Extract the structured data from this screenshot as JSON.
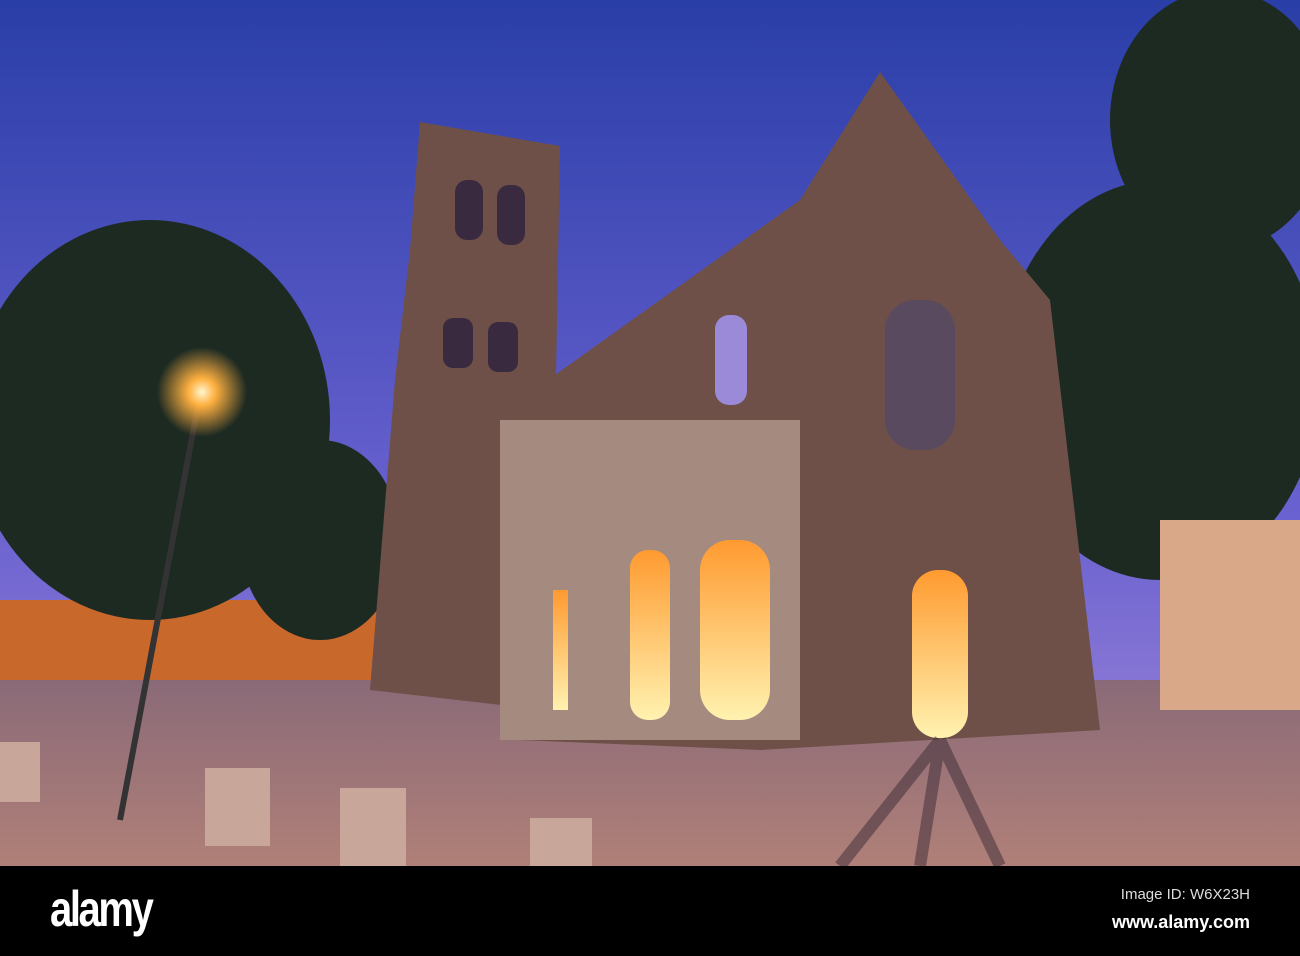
{
  "watermark": {
    "brand": "alamy",
    "image_id": "Image ID: W6X23H",
    "url": "www.alamy.com"
  },
  "colors": {
    "sky_top": "#2a3ea8",
    "sky_bottom": "#8a7ad8",
    "stone": "#7a5a4c",
    "glow": "#ffb84a"
  }
}
